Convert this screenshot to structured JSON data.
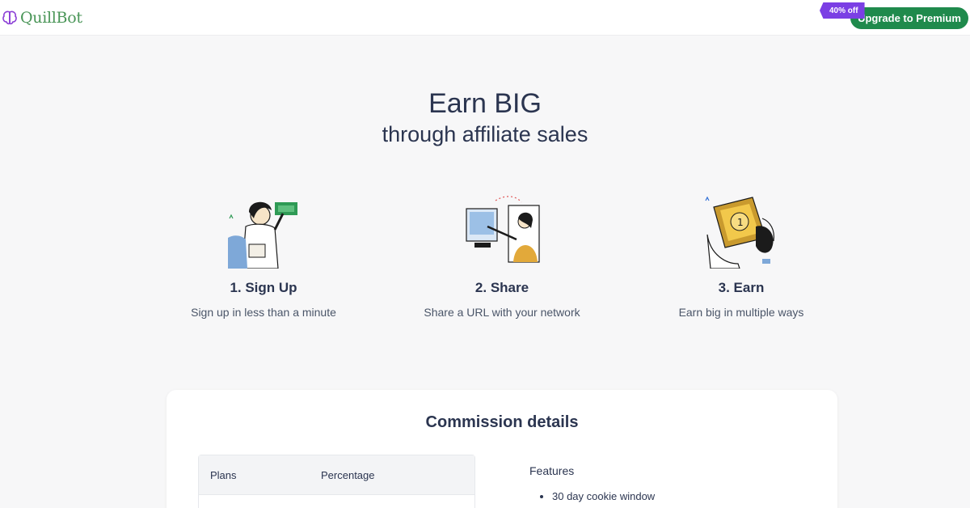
{
  "header": {
    "logo_text": "QuillBot",
    "promo_badge": "40% off",
    "upgrade_label": "Upgrade to Premium",
    "brand_color": "#499557",
    "upgrade_color": "#1f8a4c",
    "promo_color": "#7b3fe4"
  },
  "hero": {
    "title": "Earn BIG",
    "subtitle": "through affiliate sales"
  },
  "steps": [
    {
      "title": "1. Sign Up",
      "description": "Sign up in less than a minute",
      "icon": "sign-up-illustration"
    },
    {
      "title": "2. Share",
      "description": "Share a URL with your network",
      "icon": "share-illustration"
    },
    {
      "title": "3. Earn",
      "description": "Earn big in multiple ways",
      "icon": "earn-illustration"
    }
  ],
  "commission": {
    "title": "Commission details",
    "table_headers": [
      "Plans",
      "Percentage"
    ],
    "features_title": "Features",
    "features": [
      "30 day cookie window"
    ]
  }
}
